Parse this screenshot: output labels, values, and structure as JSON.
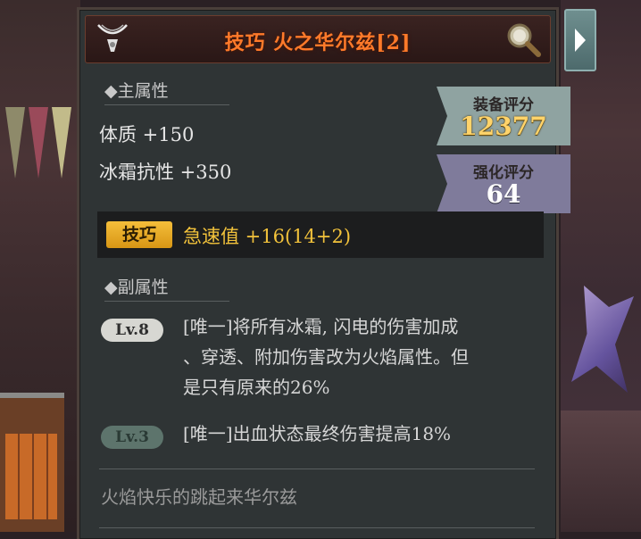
{
  "item": {
    "title": "技巧 火之华尔兹[2]",
    "title_color": "#ff7a2a"
  },
  "icons": {
    "item_icon": "necklace-icon",
    "inspect_icon": "magnifier-icon",
    "expand_icon": "chevron-right-icon"
  },
  "main_attributes": {
    "header": "◆主属性",
    "stats": [
      "体质 +150",
      "冰霜抗性 +350"
    ]
  },
  "scores": {
    "equip_label": "装备评分",
    "equip_value": "12377",
    "enhance_label": "强化评分",
    "enhance_value": "64"
  },
  "bonus": {
    "badge": "技巧",
    "text": "急速值 +16(14+2)"
  },
  "sub_attributes": {
    "header": "◆副属性",
    "affixes": [
      {
        "level": "Lv.8",
        "lines": [
          "[唯一]将所有冰霜, 闪电的伤害加成",
          "、穿透、附加伤害改为火焰属性。但",
          "是只有原来的26%"
        ]
      },
      {
        "level": "Lv.3",
        "lines": [
          "[唯一]出血状态最终伤害提高18%"
        ]
      }
    ]
  },
  "flavor_text": "火焰快乐的跳起来华尔兹",
  "colors": {
    "panel": "#2f3435",
    "bonus_text": "#f2c23b",
    "badge": "#e8aa22",
    "equip_score": "#ffd36a",
    "enhance_score": "#ffffff"
  }
}
